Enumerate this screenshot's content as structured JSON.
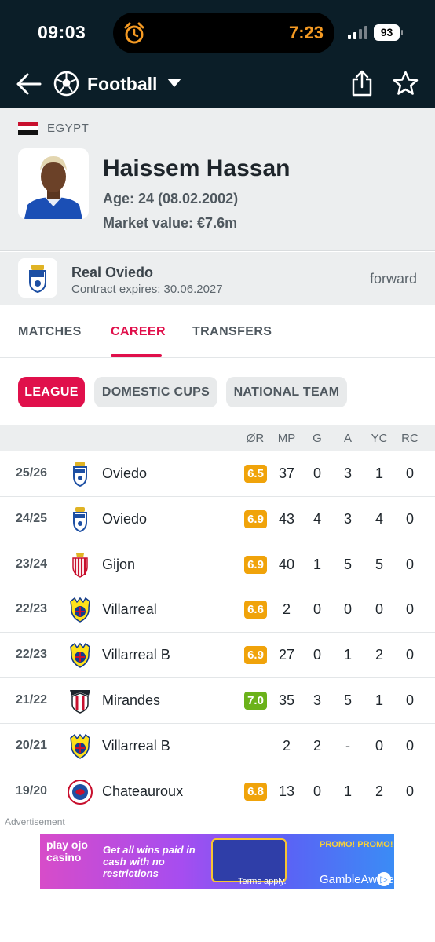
{
  "status_bar": {
    "time": "09:03",
    "island_time": "7:23",
    "battery": "93"
  },
  "header": {
    "title": "Football"
  },
  "player": {
    "country": "EGYPT",
    "name": "Haissem Hassan",
    "age": "Age: 24 (08.02.2002)",
    "market_value": "Market value: €7.6m"
  },
  "club": {
    "name": "Real Oviedo",
    "contract": "Contract expires: 30.06.2027",
    "position": "forward"
  },
  "tabs": [
    {
      "label": "MATCHES"
    },
    {
      "label": "CAREER"
    },
    {
      "label": "TRANSFERS"
    }
  ],
  "chips": [
    {
      "label": "LEAGUE"
    },
    {
      "label": "DOMESTIC CUPS"
    },
    {
      "label": "NATIONAL TEAM"
    }
  ],
  "table": {
    "headers": {
      "rating": "ØR",
      "mp": "MP",
      "g": "G",
      "a": "A",
      "yc": "YC",
      "rc": "RC"
    },
    "rows": [
      {
        "season": "25/26",
        "team": "Oviedo",
        "rating": "6.5",
        "mp": "37",
        "g": "0",
        "a": "3",
        "yc": "1",
        "rc": "0"
      },
      {
        "season": "24/25",
        "team": "Oviedo",
        "rating": "6.9",
        "mp": "43",
        "g": "4",
        "a": "3",
        "yc": "4",
        "rc": "0"
      },
      {
        "season": "23/24",
        "team": "Gijon",
        "rating": "6.9",
        "mp": "40",
        "g": "1",
        "a": "5",
        "yc": "5",
        "rc": "0"
      },
      {
        "season": "22/23",
        "team": "Villarreal",
        "rating": "6.6",
        "mp": "2",
        "g": "0",
        "a": "0",
        "yc": "0",
        "rc": "0"
      },
      {
        "season": "22/23",
        "team": "Villarreal B",
        "rating": "6.9",
        "mp": "27",
        "g": "0",
        "a": "1",
        "yc": "2",
        "rc": "0"
      },
      {
        "season": "21/22",
        "team": "Mirandes",
        "rating": "7.0",
        "mp": "35",
        "g": "3",
        "a": "5",
        "yc": "1",
        "rc": "0"
      },
      {
        "season": "20/21",
        "team": "Villarreal B",
        "rating": "",
        "mp": "2",
        "g": "2",
        "a": "-",
        "yc": "0",
        "rc": "0"
      },
      {
        "season": "19/20",
        "team": "Chateauroux",
        "rating": "6.8",
        "mp": "13",
        "g": "0",
        "a": "1",
        "yc": "2",
        "rc": "0"
      }
    ]
  },
  "ad": {
    "label": "Advertisement",
    "brand": "play ojo casino",
    "copy": "Get all wins paid in cash with no restrictions",
    "promo": "PROMO! PROMO!",
    "terms": "Terms apply.",
    "gamble": "GambleAware"
  },
  "colors": {
    "header_bg": "#0b1e28",
    "accent": "#e0104b",
    "rating_orange": "#f0a30a",
    "rating_green": "#6bb21a"
  }
}
